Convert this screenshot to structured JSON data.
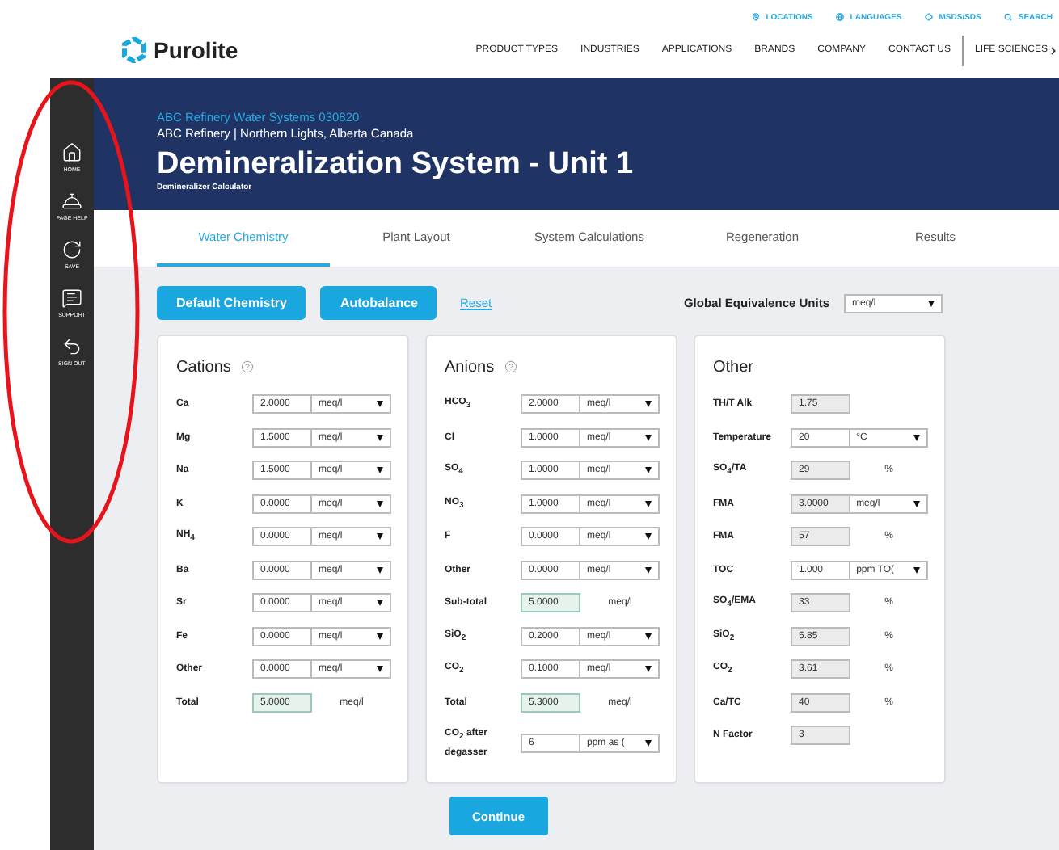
{
  "utility_links": [
    "LOCATIONS",
    "LANGUAGES",
    "MSDS/SDS",
    "SEARCH"
  ],
  "logo": {
    "name": "Purolite"
  },
  "nav": [
    "PRODUCT TYPES",
    "INDUSTRIES",
    "APPLICATIONS",
    "BRANDS",
    "COMPANY",
    "CONTACT US"
  ],
  "nav_extra": {
    "label": "LIFE SCIENCES"
  },
  "sidebar": {
    "items": [
      "HOME",
      "PAGE HELP",
      "SAVE",
      "SUPPORT",
      "SIGN OUT"
    ],
    "highlighted": true
  },
  "banner": {
    "project": "ABC Refinery Water Systems 030820",
    "site": "ABC Refinery | Northern Lights, Alberta Canada",
    "title": "Demineralization System - Unit 1",
    "subtitle": "Demineralizer Calculator"
  },
  "tabs": [
    {
      "label": "Water Chemistry",
      "selected": true
    },
    {
      "label": "Plant Layout",
      "selected": false
    },
    {
      "label": "System Calculations",
      "selected": false
    },
    {
      "label": "Regeneration",
      "selected": false
    },
    {
      "label": "Results",
      "selected": false
    }
  ],
  "toolbar": {
    "buttons": [
      "Default Chemistry",
      "Autobalance"
    ],
    "link": "Reset",
    "units_label": "Global Equivalence Units",
    "units_value": "meq/l"
  },
  "panels": [
    {
      "title": "Cations",
      "help": true,
      "rows": [
        {
          "kind": "select",
          "label": "Ca",
          "value": "2.0000",
          "unit": "meq/l",
          "readonly": false
        },
        {
          "kind": "select",
          "label": "Mg",
          "value": "1.5000",
          "unit": "meq/l",
          "readonly": false
        },
        {
          "kind": "select",
          "label": "Na",
          "value": "1.5000",
          "unit": "meq/l",
          "readonly": false
        },
        {
          "kind": "select",
          "label": "K",
          "value": "0.0000",
          "unit": "meq/l",
          "readonly": false
        },
        {
          "kind": "select",
          "label": "NH$_{4}$",
          "value": "0.0000",
          "unit": "meq/l",
          "readonly": false
        },
        {
          "kind": "select",
          "label": "Ba",
          "value": "0.0000",
          "unit": "meq/l",
          "readonly": false
        },
        {
          "kind": "select",
          "label": "Sr",
          "value": "0.0000",
          "unit": "meq/l",
          "readonly": false
        },
        {
          "kind": "select",
          "label": "Fe",
          "value": "0.0000",
          "unit": "meq/l",
          "readonly": false
        },
        {
          "kind": "select",
          "label": "Other",
          "value": "0.0000",
          "unit": "meq/l",
          "readonly": false
        },
        {
          "kind": "total",
          "label": "Total",
          "value": "5.0000",
          "unit": "meq/l"
        }
      ]
    },
    {
      "title": "Anions",
      "help": true,
      "rows": [
        {
          "kind": "select",
          "label": "HCO$_{3}$",
          "value": "2.0000",
          "unit": "meq/l",
          "readonly": false
        },
        {
          "kind": "select",
          "label": "Cl",
          "value": "1.0000",
          "unit": "meq/l",
          "readonly": false
        },
        {
          "kind": "select",
          "label": "SO$_{4}$",
          "value": "1.0000",
          "unit": "meq/l",
          "readonly": false
        },
        {
          "kind": "select",
          "label": "NO$_{3}$",
          "value": "1.0000",
          "unit": "meq/l",
          "readonly": false
        },
        {
          "kind": "select",
          "label": "F",
          "value": "0.0000",
          "unit": "meq/l",
          "readonly": false
        },
        {
          "kind": "select",
          "label": "Other",
          "value": "0.0000",
          "unit": "meq/l",
          "readonly": false
        },
        {
          "kind": "total",
          "label": "Sub-total",
          "value": "5.0000",
          "unit": "meq/l"
        },
        {
          "kind": "select",
          "label": "SiO$_{2}$",
          "value": "0.2000",
          "unit": "meq/l",
          "readonly": false
        },
        {
          "kind": "select",
          "label": "CO$_{2}$",
          "value": "0.1000",
          "unit": "meq/l",
          "readonly": false
        },
        {
          "kind": "total",
          "label": "Total",
          "value": "5.3000",
          "unit": "meq/l"
        },
        {
          "kind": "select",
          "label": "CO$_{2}$ after degasser",
          "value": "6",
          "unit": "ppm as (",
          "readonly": false
        }
      ]
    },
    {
      "title": "Other",
      "help": false,
      "rows": [
        {
          "kind": "output",
          "label": "TH/T Alk",
          "value": "1.75"
        },
        {
          "kind": "select",
          "label": "Temperature",
          "value": "20",
          "unit": "°C",
          "readonly": false
        },
        {
          "kind": "output",
          "label": "SO$_{4}$/TA",
          "value": "29",
          "unit": "%"
        },
        {
          "kind": "select",
          "label": "FMA",
          "value": "3.0000",
          "unit": "meq/l",
          "readonly": true
        },
        {
          "kind": "output",
          "label": "FMA",
          "value": "57",
          "unit": "%"
        },
        {
          "kind": "select",
          "label": "TOC",
          "value": "1.000",
          "unit": "ppm TO(",
          "readonly": false
        },
        {
          "kind": "output",
          "label": "SO$_{4}$/EMA",
          "value": "33",
          "unit": "%"
        },
        {
          "kind": "output",
          "label": "SiO$_{2}$",
          "value": "5.85",
          "unit": "%"
        },
        {
          "kind": "output",
          "label": "CO$_{2}$",
          "value": "3.61",
          "unit": "%"
        },
        {
          "kind": "output",
          "label": "Ca/TC",
          "value": "40",
          "unit": "%"
        },
        {
          "kind": "output",
          "label": "N Factor",
          "value": "3"
        }
      ]
    }
  ],
  "continue_button": "Continue"
}
